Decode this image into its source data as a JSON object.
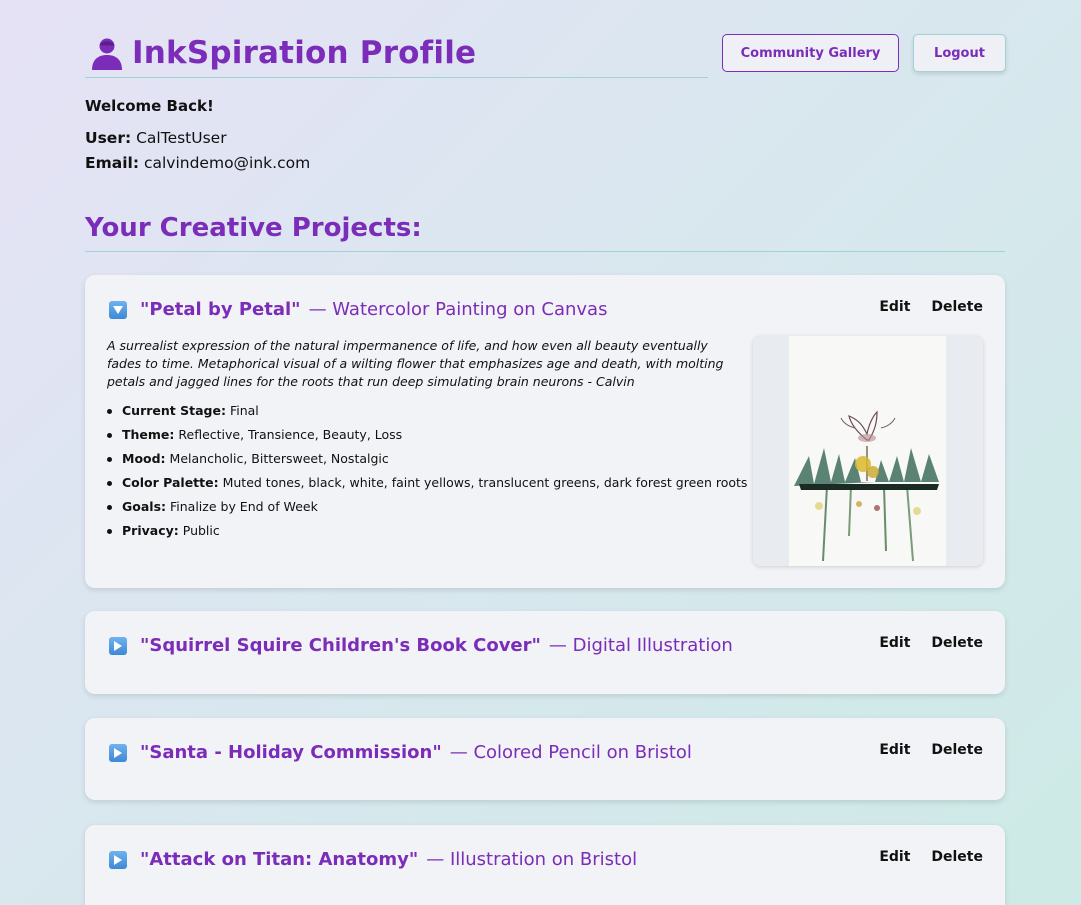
{
  "header": {
    "title": "InkSpiration Profile",
    "gallery_button": "Community Gallery",
    "logout_button": "Logout"
  },
  "profile": {
    "welcome": "Welcome Back!",
    "user_label": "User:",
    "user_value": "CalTestUser",
    "email_label": "Email:",
    "email_value": "calvindemo@ink.com"
  },
  "projects_heading": "Your Creative Projects:",
  "projects": [
    {
      "name": "\"Petal by Petal\"",
      "medium": "— Watercolor Painting on Canvas",
      "expanded": true,
      "edit": "Edit",
      "delete": "Delete",
      "description": "A surrealist expression of the natural impermanence of life, and how even all beauty eventually fades to time. Metaphorical visual of a wilting flower that emphasizes age and death, with molting petals and jagged lines for the roots that run deep simulating brain neurons - Calvin",
      "details": [
        {
          "label": "Current Stage:",
          "value": "Final"
        },
        {
          "label": "Theme:",
          "value": "Reflective, Transience, Beauty, Loss"
        },
        {
          "label": "Mood:",
          "value": "Melancholic, Bittersweet, Nostalgic"
        },
        {
          "label": "Color Palette:",
          "value": "Muted tones, black, white, faint yellows, translucent greens, dark forest green roots"
        },
        {
          "label": "Goals:",
          "value": "Finalize by End of Week"
        },
        {
          "label": "Privacy:",
          "value": "Public"
        }
      ]
    },
    {
      "name": "\"Squirrel Squire Children's Book Cover\"",
      "medium": "— Digital Illustration",
      "expanded": false,
      "edit": "Edit",
      "delete": "Delete"
    },
    {
      "name": "\"Santa - Holiday Commission\"",
      "medium": "— Colored Pencil on Bristol",
      "expanded": false,
      "edit": "Edit",
      "delete": "Delete"
    },
    {
      "name": "\"Attack on Titan: Anatomy\"",
      "medium": "— Illustration on Bristol",
      "expanded": false,
      "edit": "Edit",
      "delete": "Delete"
    }
  ],
  "colors": {
    "accent": "#7b2cb8",
    "divider": "#9fd3d6",
    "card_bg": "#f1f3f6",
    "toggle_icon": "#4a90e2"
  },
  "icons": {
    "title": "user-icon",
    "expanded": "triangle-down-icon",
    "collapsed": "triangle-right-icon"
  }
}
